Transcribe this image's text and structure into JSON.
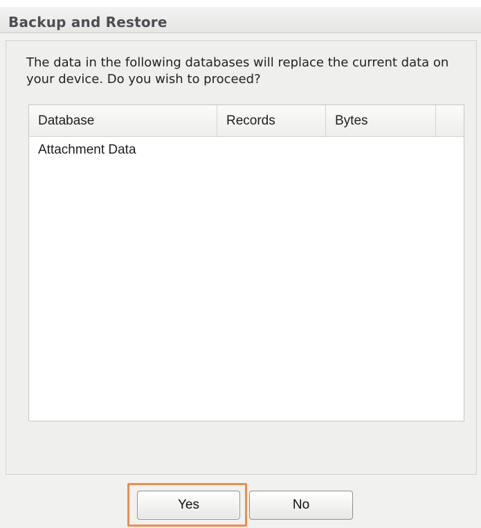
{
  "dialog": {
    "title": "Backup and Restore",
    "message": "The data in the following databases will replace the current data on your device. Do you wish to proceed?"
  },
  "table": {
    "columns": [
      "Database",
      "Records",
      "Bytes"
    ],
    "rows": [
      {
        "database": "Attachment Data",
        "records": "",
        "bytes": ""
      }
    ]
  },
  "buttons": {
    "yes_label": "Yes",
    "no_label": "No"
  },
  "colors": {
    "highlight": "#f08a4b",
    "title_text": "#4b4e52"
  }
}
